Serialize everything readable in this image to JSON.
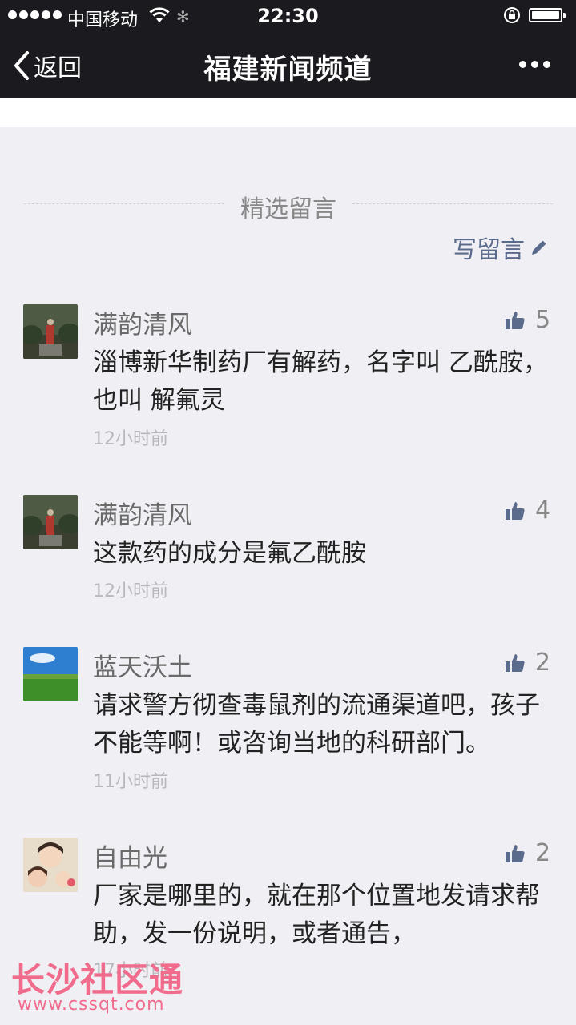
{
  "status_bar": {
    "carrier": "中国移动",
    "time": "22:30"
  },
  "nav": {
    "back_label": "返回",
    "title": "福建新闻频道"
  },
  "section": {
    "title": "精选留言",
    "write_label": "写留言"
  },
  "comments": [
    {
      "name": "满韵清风",
      "likes": "5",
      "text": "淄博新华制药厂有解药，名字叫 乙酰胺，也叫 解氟灵",
      "time": "12小时前"
    },
    {
      "name": "满韵清风",
      "likes": "4",
      "text": "这款药的成分是氟乙酰胺",
      "time": "12小时前"
    },
    {
      "name": "蓝天沃土",
      "likes": "2",
      "text": "请求警方彻查毒鼠剂的流通渠道吧，孩子不能等啊！或咨询当地的科研部门。",
      "time": "11小时前"
    },
    {
      "name": "自由光",
      "likes": "2",
      "text": "厂家是哪里的，就在那个位置地发请求帮助，发一份说明，或者通告，",
      "time": "17小时前"
    }
  ],
  "watermark": {
    "name": "长沙社区通",
    "url": "www.cssqt.com"
  },
  "colors": {
    "nav_background": "#1b1b1f",
    "page_background": "#efeff4",
    "link_blue": "#5b6b8c",
    "watermark_pink": "#f06b8c"
  },
  "icons": [
    "signal-dots-icon",
    "wifi-icon",
    "loading-spinner-icon",
    "rotation-lock-icon",
    "battery-icon",
    "back-chevron-icon",
    "more-dots-icon",
    "pencil-icon",
    "thumbs-up-icon"
  ]
}
